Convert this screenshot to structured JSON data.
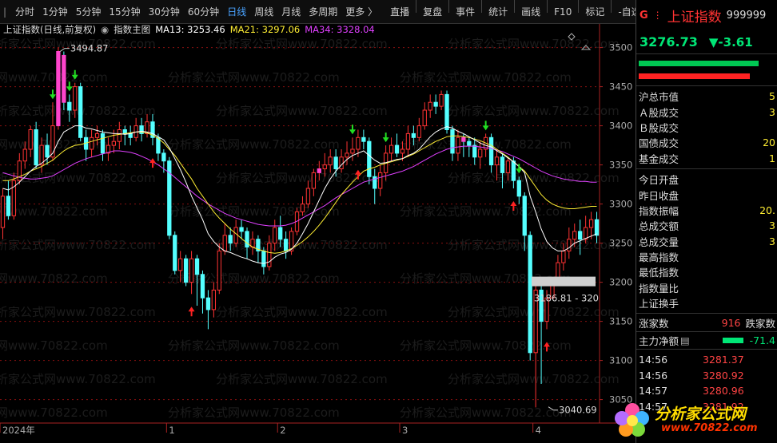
{
  "toolbar": {
    "left": "|",
    "periods": [
      "分时",
      "1分钟",
      "5分钟",
      "15分钟",
      "30分钟",
      "60分钟",
      "日线",
      "周线",
      "月线",
      "多周期",
      "更多 〉"
    ],
    "active_index": 6,
    "tools": [
      "直播",
      "复盘",
      "事件",
      "统计",
      "画线",
      "F10",
      "标记",
      "-自选",
      "返回"
    ]
  },
  "legend": {
    "title": "上证指数(日线,前复权)",
    "main": "指数主图",
    "ma13": "MA13: 3253.46",
    "ma21": "MA21: 3297.06",
    "ma34": "MA34: 3328.04"
  },
  "colors": {
    "up": "#ff3333",
    "down": "#54ffff",
    "ma13": "#ffffff",
    "ma21": "#ffee33",
    "ma34": "#e040ff",
    "grid": "#881111"
  },
  "watermark": "分析家公式网www.70822.com",
  "chart_data": {
    "type": "candlestick",
    "ylim": [
      3020,
      3520
    ],
    "yticks": [
      3050,
      3100,
      3150,
      3200,
      3250,
      3300,
      3350,
      3400,
      3450,
      3500
    ],
    "x_labels": [
      {
        "index": 0,
        "label": "2024年"
      },
      {
        "index": 30,
        "label": "1"
      },
      {
        "index": 50,
        "label": "2"
      },
      {
        "index": 72,
        "label": "3"
      },
      {
        "index": 96,
        "label": "4"
      }
    ],
    "high_label": {
      "index": 10,
      "value": 3494.87,
      "text": "3494.87"
    },
    "low_label": {
      "index": 98,
      "value": 3040.69,
      "text": "3040.69"
    },
    "price_box": {
      "value": 3200,
      "text": "3186.81 - 320"
    },
    "candles": [
      [
        3270,
        3310,
        3320,
        3255
      ],
      [
        3310,
        3285,
        3330,
        3280
      ],
      [
        3285,
        3330,
        3340,
        3280
      ],
      [
        3330,
        3355,
        3365,
        3325
      ],
      [
        3355,
        3370,
        3380,
        3345
      ],
      [
        3370,
        3395,
        3400,
        3360
      ],
      [
        3395,
        3350,
        3405,
        3345
      ],
      [
        3350,
        3375,
        3385,
        3340
      ],
      [
        3375,
        3360,
        3390,
        3350
      ],
      [
        3360,
        3400,
        3430,
        3355
      ],
      [
        3400,
        3495,
        3500,
        3395
      ],
      [
        3490,
        3430,
        3495,
        3420
      ],
      [
        3430,
        3420,
        3440,
        3405
      ],
      [
        3420,
        3450,
        3455,
        3410
      ],
      [
        3450,
        3385,
        3455,
        3380
      ],
      [
        3385,
        3370,
        3395,
        3355
      ],
      [
        3370,
        3385,
        3395,
        3360
      ],
      [
        3385,
        3390,
        3400,
        3375
      ],
      [
        3390,
        3365,
        3395,
        3355
      ],
      [
        3365,
        3375,
        3385,
        3355
      ],
      [
        3375,
        3380,
        3395,
        3365
      ],
      [
        3380,
        3395,
        3405,
        3370
      ],
      [
        3395,
        3390,
        3400,
        3375
      ],
      [
        3390,
        3385,
        3400,
        3375
      ],
      [
        3385,
        3400,
        3410,
        3380
      ],
      [
        3400,
        3390,
        3410,
        3380
      ],
      [
        3390,
        3405,
        3415,
        3385
      ],
      [
        3405,
        3385,
        3415,
        3375
      ],
      [
        3385,
        3365,
        3390,
        3355
      ],
      [
        3365,
        3355,
        3370,
        3340
      ],
      [
        3355,
        3260,
        3360,
        3255
      ],
      [
        3260,
        3215,
        3265,
        3210
      ],
      [
        3215,
        3230,
        3240,
        3200
      ],
      [
        3230,
        3200,
        3235,
        3195
      ],
      [
        3200,
        3230,
        3240,
        3185
      ],
      [
        3230,
        3210,
        3235,
        3170
      ],
      [
        3210,
        3180,
        3215,
        3160
      ],
      [
        3180,
        3165,
        3190,
        3140
      ],
      [
        3165,
        3190,
        3200,
        3155
      ],
      [
        3190,
        3240,
        3250,
        3185
      ],
      [
        3240,
        3260,
        3275,
        3235
      ],
      [
        3260,
        3250,
        3270,
        3240
      ],
      [
        3250,
        3270,
        3280,
        3245
      ],
      [
        3270,
        3265,
        3280,
        3255
      ],
      [
        3265,
        3245,
        3270,
        3230
      ],
      [
        3245,
        3255,
        3265,
        3235
      ],
      [
        3255,
        3240,
        3260,
        3225
      ],
      [
        3240,
        3220,
        3245,
        3210
      ],
      [
        3220,
        3250,
        3260,
        3215
      ],
      [
        3250,
        3270,
        3280,
        3240
      ],
      [
        3270,
        3255,
        3285,
        3245
      ],
      [
        3255,
        3240,
        3265,
        3230
      ],
      [
        3240,
        3265,
        3270,
        3235
      ],
      [
        3265,
        3290,
        3295,
        3260
      ],
      [
        3290,
        3300,
        3310,
        3285
      ],
      [
        3300,
        3320,
        3330,
        3295
      ],
      [
        3320,
        3340,
        3345,
        3310
      ],
      [
        3340,
        3345,
        3355,
        3330
      ],
      [
        3345,
        3350,
        3365,
        3335
      ],
      [
        3350,
        3360,
        3370,
        3340
      ],
      [
        3360,
        3345,
        3370,
        3335
      ],
      [
        3345,
        3360,
        3370,
        3340
      ],
      [
        3360,
        3365,
        3380,
        3350
      ],
      [
        3365,
        3370,
        3385,
        3355
      ],
      [
        3370,
        3385,
        3395,
        3360
      ],
      [
        3385,
        3380,
        3395,
        3370
      ],
      [
        3380,
        3335,
        3385,
        3325
      ],
      [
        3335,
        3320,
        3345,
        3300
      ],
      [
        3320,
        3340,
        3350,
        3310
      ],
      [
        3340,
        3365,
        3375,
        3330
      ],
      [
        3365,
        3375,
        3385,
        3355
      ],
      [
        3375,
        3365,
        3390,
        3360
      ],
      [
        3365,
        3370,
        3380,
        3355
      ],
      [
        3370,
        3390,
        3400,
        3360
      ],
      [
        3390,
        3385,
        3400,
        3375
      ],
      [
        3385,
        3400,
        3410,
        3380
      ],
      [
        3400,
        3420,
        3430,
        3395
      ],
      [
        3420,
        3430,
        3440,
        3410
      ],
      [
        3430,
        3425,
        3440,
        3415
      ],
      [
        3425,
        3440,
        3445,
        3420
      ],
      [
        3440,
        3395,
        3445,
        3390
      ],
      [
        3395,
        3365,
        3400,
        3355
      ],
      [
        3365,
        3385,
        3395,
        3355
      ],
      [
        3385,
        3380,
        3390,
        3360
      ],
      [
        3380,
        3375,
        3385,
        3360
      ],
      [
        3375,
        3360,
        3385,
        3350
      ],
      [
        3360,
        3370,
        3380,
        3345
      ],
      [
        3370,
        3385,
        3390,
        3360
      ],
      [
        3385,
        3350,
        3390,
        3340
      ],
      [
        3350,
        3360,
        3370,
        3330
      ],
      [
        3360,
        3340,
        3365,
        3320
      ],
      [
        3340,
        3355,
        3360,
        3330
      ],
      [
        3355,
        3330,
        3360,
        3320
      ],
      [
        3330,
        3310,
        3335,
        3300
      ],
      [
        3310,
        3260,
        3315,
        3240
      ],
      [
        3260,
        3110,
        3265,
        3100
      ],
      [
        3110,
        3190,
        3200,
        3040
      ],
      [
        3190,
        3150,
        3200,
        3070
      ],
      [
        3150,
        3180,
        3190,
        3140
      ],
      [
        3180,
        3200,
        3205,
        3185
      ],
      [
        3200,
        3225,
        3235,
        3195
      ],
      [
        3225,
        3240,
        3250,
        3215
      ],
      [
        3240,
        3255,
        3270,
        3230
      ],
      [
        3255,
        3265,
        3275,
        3245
      ],
      [
        3265,
        3255,
        3280,
        3235
      ],
      [
        3255,
        3270,
        3285,
        3250
      ],
      [
        3270,
        3280,
        3290,
        3255
      ],
      [
        3280,
        3260,
        3290,
        3250
      ]
    ],
    "ma13": [
      3320,
      3318,
      3322,
      3328,
      3335,
      3342,
      3348,
      3352,
      3358,
      3365,
      3380,
      3392,
      3396,
      3400,
      3400,
      3397,
      3396,
      3394,
      3392,
      3391,
      3390,
      3390,
      3389,
      3390,
      3392,
      3393,
      3392,
      3390,
      3386,
      3382,
      3372,
      3358,
      3344,
      3328,
      3310,
      3295,
      3280,
      3262,
      3252,
      3245,
      3240,
      3238,
      3235,
      3232,
      3230,
      3227,
      3225,
      3224,
      3226,
      3232,
      3236,
      3238,
      3242,
      3250,
      3262,
      3275,
      3290,
      3305,
      3320,
      3332,
      3342,
      3350,
      3357,
      3362,
      3365,
      3368,
      3362,
      3356,
      3352,
      3353,
      3355,
      3357,
      3358,
      3362,
      3365,
      3370,
      3378,
      3386,
      3392,
      3396,
      3399,
      3397,
      3393,
      3390,
      3386,
      3382,
      3378,
      3375,
      3373,
      3368,
      3364,
      3359,
      3354,
      3348,
      3340,
      3310,
      3290,
      3268,
      3252,
      3244,
      3240,
      3240,
      3244,
      3250,
      3253,
      3256,
      3259,
      3262
    ],
    "ma21": [
      3330,
      3330,
      3332,
      3335,
      3338,
      3342,
      3345,
      3348,
      3352,
      3356,
      3362,
      3368,
      3372,
      3375,
      3376,
      3378,
      3380,
      3382,
      3384,
      3386,
      3388,
      3389,
      3390,
      3391,
      3392,
      3392,
      3391,
      3388,
      3384,
      3378,
      3370,
      3362,
      3352,
      3342,
      3332,
      3320,
      3310,
      3300,
      3290,
      3282,
      3275,
      3268,
      3262,
      3256,
      3250,
      3245,
      3242,
      3240,
      3238,
      3237,
      3238,
      3240,
      3243,
      3247,
      3252,
      3258,
      3265,
      3273,
      3282,
      3292,
      3302,
      3312,
      3320,
      3328,
      3335,
      3342,
      3345,
      3347,
      3350,
      3352,
      3354,
      3356,
      3358,
      3361,
      3364,
      3368,
      3372,
      3376,
      3380,
      3383,
      3386,
      3387,
      3387,
      3386,
      3385,
      3383,
      3381,
      3378,
      3375,
      3370,
      3365,
      3360,
      3354,
      3348,
      3342,
      3332,
      3322,
      3312,
      3305,
      3300,
      3297,
      3295,
      3294,
      3294,
      3295,
      3296,
      3297,
      3297
    ],
    "ma34": [
      3340,
      3338,
      3336,
      3334,
      3333,
      3332,
      3332,
      3333,
      3334,
      3336,
      3340,
      3344,
      3348,
      3352,
      3355,
      3358,
      3360,
      3362,
      3364,
      3366,
      3368,
      3368,
      3367,
      3366,
      3364,
      3361,
      3358,
      3354,
      3350,
      3345,
      3340,
      3334,
      3328,
      3322,
      3316,
      3310,
      3305,
      3300,
      3296,
      3292,
      3288,
      3285,
      3282,
      3280,
      3278,
      3276,
      3274,
      3273,
      3272,
      3272,
      3272,
      3273,
      3275,
      3278,
      3282,
      3286,
      3290,
      3294,
      3298,
      3303,
      3308,
      3312,
      3316,
      3320,
      3324,
      3328,
      3330,
      3332,
      3334,
      3336,
      3338,
      3340,
      3342,
      3345,
      3348,
      3352,
      3356,
      3360,
      3364,
      3367,
      3370,
      3372,
      3373,
      3374,
      3374,
      3374,
      3373,
      3372,
      3371,
      3369,
      3367,
      3364,
      3361,
      3358,
      3354,
      3350,
      3346,
      3342,
      3339,
      3336,
      3334,
      3332,
      3331,
      3330,
      3329,
      3329,
      3328,
      3328
    ],
    "buy_arrows": [
      27,
      34,
      64,
      92,
      98
    ],
    "sell_arrows": [
      9,
      12,
      13,
      63,
      69,
      87,
      93
    ]
  },
  "right_panel": {
    "flag": "G",
    "dots": "⋮",
    "name": "上证指数",
    "code": "999999",
    "price": "3276.73",
    "change": "▼-3.61",
    "bar_green_pct": 0.88,
    "bar_red_pct": 0.82,
    "market_rows": [
      {
        "label": "沪总市值",
        "value": "5"
      },
      {
        "label": "Ａ股成交",
        "value": "3"
      },
      {
        "label": "Ｂ股成交",
        "value": ""
      },
      {
        "label": "国债成交",
        "value": "20"
      },
      {
        "label": "基金成交",
        "value": "1"
      }
    ],
    "stat_rows": [
      {
        "label": "今日开盘",
        "value": ""
      },
      {
        "label": "昨日收盘",
        "value": ""
      },
      {
        "label": "指数振幅",
        "value": "20."
      },
      {
        "label": "总成交额",
        "value": "3"
      },
      {
        "label": "总成交量",
        "value": "3"
      },
      {
        "label": "最高指数",
        "value": ""
      },
      {
        "label": "最低指数",
        "value": ""
      },
      {
        "label": "指数量比",
        "value": ""
      },
      {
        "label": "上证换手",
        "value": ""
      }
    ],
    "up_label": "涨家数",
    "up_value": "916",
    "down_label": "跌家数",
    "flow_label": "主力净额",
    "flow_icon": "▤",
    "flow_value": "-71.4",
    "ticks": [
      {
        "time": "14:56",
        "price": "3281.37"
      },
      {
        "time": "14:56",
        "price": "3280.92"
      },
      {
        "time": "14:57",
        "price": "3280.96"
      },
      {
        "time": "14:57",
        "price": "3281.92"
      }
    ]
  },
  "logo": {
    "text": "分析家公式网",
    "url": "www.70822.com"
  }
}
